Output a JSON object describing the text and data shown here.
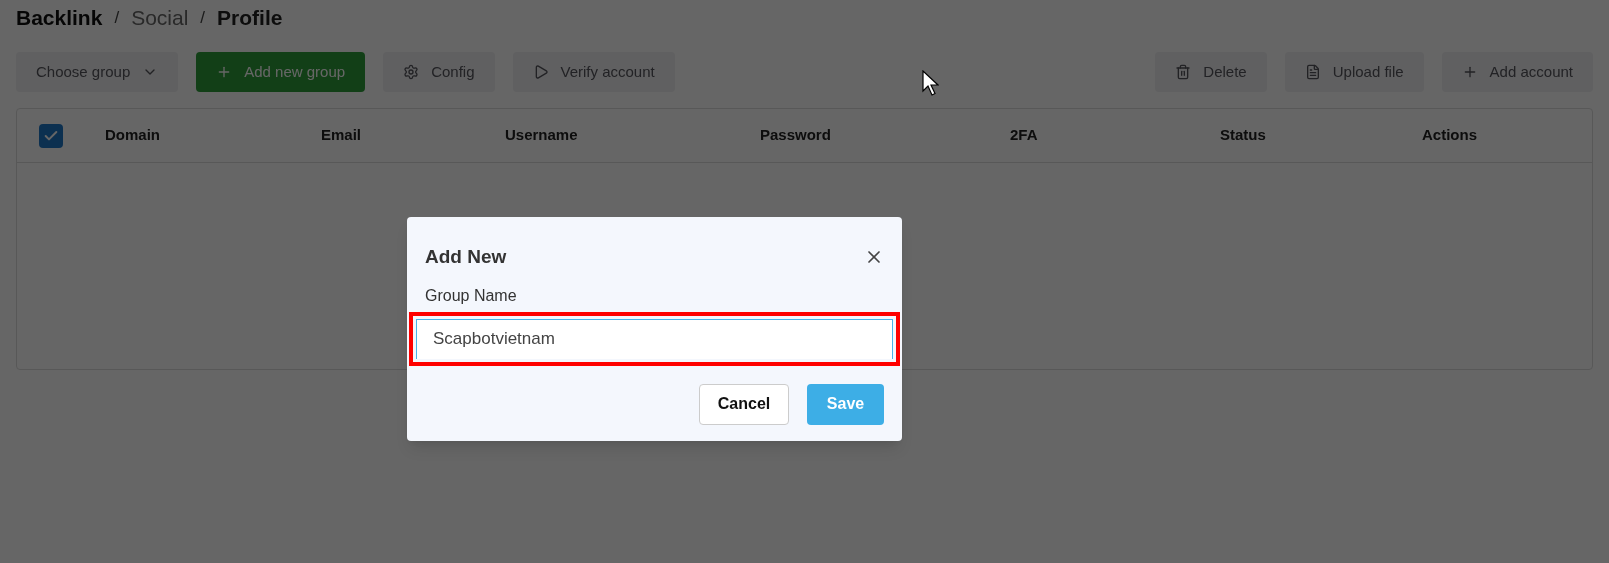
{
  "breadcrumb_separator": "/",
  "breadcrumb": [
    {
      "label": "Backlink",
      "current": false,
      "bold": true
    },
    {
      "label": "Social",
      "current": false,
      "bold": false
    },
    {
      "label": "Profile",
      "current": true,
      "bold": true
    }
  ],
  "toolbar_left": [
    {
      "kind": "select",
      "label": "Choose group",
      "disabled": true
    },
    {
      "kind": "add",
      "label": "Add new group",
      "disabled": false,
      "primary": true
    },
    {
      "kind": "config",
      "label": "Config",
      "disabled": true,
      "primary": false
    },
    {
      "kind": "verify",
      "label": "Verify account",
      "disabled": true,
      "primary": false
    }
  ],
  "toolbar_right": [
    {
      "kind": "delete",
      "label": "Delete",
      "disabled": true
    },
    {
      "kind": "upload",
      "label": "Upload file",
      "disabled": true
    },
    {
      "kind": "add",
      "label": "Add account",
      "disabled": true
    }
  ],
  "table": {
    "select_all": {
      "checked": true
    },
    "columns": [
      "Domain",
      "Email",
      "Username",
      "Password",
      "2FA",
      "Status",
      "Actions"
    ]
  },
  "dialog": {
    "title": "Add New",
    "field": {
      "label": "Group Name",
      "value": "Scapbotvietnam",
      "highlighted": true
    },
    "buttons": [
      {
        "kind": "cancel",
        "label": "Cancel"
      },
      {
        "kind": "save",
        "label": "Save"
      }
    ]
  }
}
